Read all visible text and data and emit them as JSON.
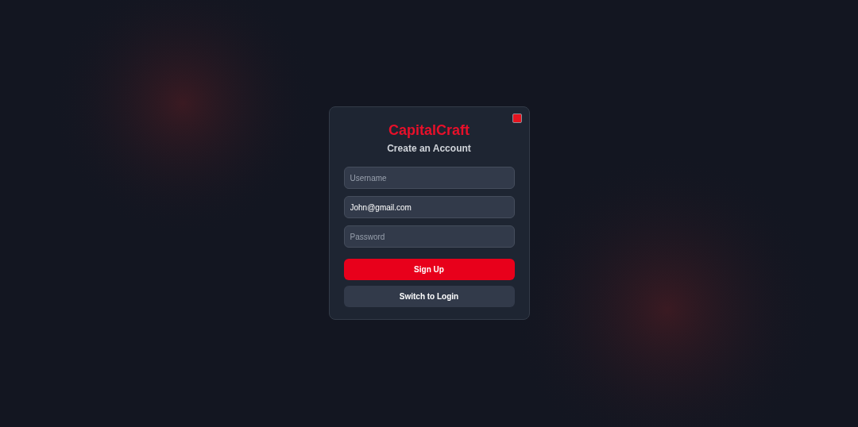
{
  "dialog": {
    "title": "CapitalCraft",
    "subtitle": "Create an Account",
    "fields": [
      {
        "placeholder": "Username"
      },
      {
        "value": "John@gmail.com"
      },
      {
        "placeholder": "Password"
      }
    ],
    "buttons": [
      {
        "label": "Sign Up",
        "kind": "primary"
      },
      {
        "label": "Switch to Login",
        "kind": "secondary"
      }
    ]
  }
}
